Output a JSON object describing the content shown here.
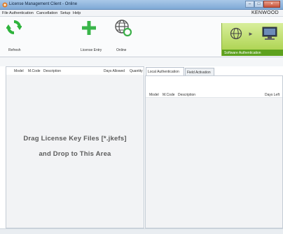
{
  "window": {
    "title": "License Management Client - Online",
    "minimize_glyph": "–",
    "maximize_glyph": "□",
    "close_glyph": "×"
  },
  "menu": {
    "items": [
      "File",
      "Authentication",
      "Cancellation",
      "Setup",
      "Help"
    ],
    "brand": "KENWOOD"
  },
  "toolbar": {
    "refresh_label": "Refresh",
    "license_entry_label": "License Entry",
    "online_label": "Online",
    "software_auth_label": "Software Authentication",
    "arrow_glyph": "►"
  },
  "left_table": {
    "columns": [
      "Model",
      "M.Code",
      "Description",
      "Days Allowed",
      "Quantity"
    ]
  },
  "drop_area": {
    "line1": "Drag License Key Files [*.jkefs]",
    "line2": "and Drop to This Area"
  },
  "tabs": [
    "Local Authentication",
    "Field Activation"
  ],
  "right_table": {
    "columns": [
      "Model",
      "M.Code",
      "Description",
      "Days Left"
    ]
  },
  "colors": {
    "accent_green": "#5da11d",
    "refresh_green": "#2eb33c",
    "titlebar": "#7fa9d6"
  },
  "icons": {
    "refresh": "refresh-icon",
    "license_entry": "plus-icon",
    "online": "globe-icon",
    "software_auth": [
      "globe-icon",
      "arrow-icon",
      "monitor-icon"
    ]
  }
}
